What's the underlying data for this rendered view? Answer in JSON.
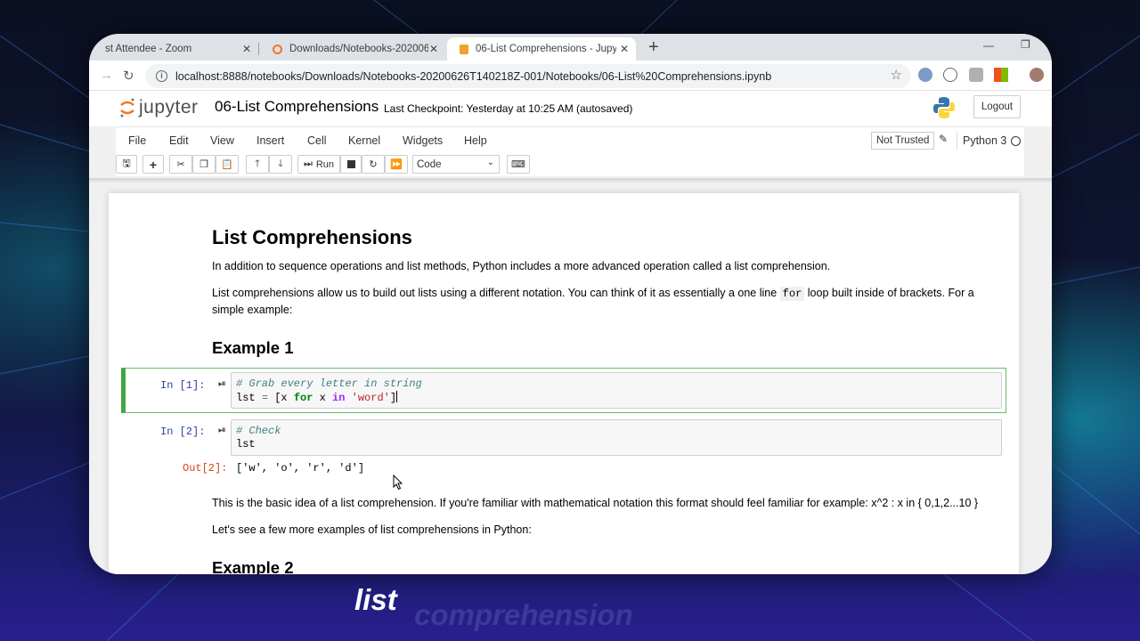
{
  "browser": {
    "tabs": [
      {
        "label": "st Attendee - Zoom"
      },
      {
        "label": "Downloads/Notebooks-2020062..."
      },
      {
        "label": "06-List Comprehensions - Jupyte"
      }
    ],
    "url": "localhost:8888/notebooks/Downloads/Notebooks-20200626T140218Z-001/Notebooks/06-List%20Comprehensions.ipynb"
  },
  "jupyter": {
    "logo_text": "jupyter",
    "notebook_title": "06-List Comprehensions",
    "checkpoint": "Last Checkpoint: Yesterday at 10:25 AM",
    "autosaved": "(autosaved)",
    "logout_label": "Logout",
    "menu": [
      "File",
      "Edit",
      "View",
      "Insert",
      "Cell",
      "Kernel",
      "Widgets",
      "Help"
    ],
    "trust_label": "Not Trusted",
    "kernel_name": "Python 3",
    "toolbar": {
      "run_label": "Run",
      "cell_type": "Code"
    }
  },
  "notebook": {
    "heading": "List Comprehensions",
    "para1": "In addition to sequence operations and list methods, Python includes a more advanced operation called a list comprehension.",
    "para2_a": "List comprehensions allow us to build out lists using a different notation. You can think of it as essentially a one line",
    "para2_code": "for",
    "para2_b": "loop built inside of brackets. For a",
    "para2_c": "simple example:",
    "example1": "Example 1",
    "cell1": {
      "prompt": "In [1]:",
      "line1_comment": "# Grab every letter in string",
      "line2_var": "lst",
      "line2_eq": "=",
      "line2_open": "[x",
      "line2_for": "for",
      "line2_x": "x",
      "line2_in": "in",
      "line2_str": "'word'",
      "line2_close": "]"
    },
    "cell2": {
      "prompt": "In [2]:",
      "line1_comment": "# Check",
      "line2": "lst",
      "out_prompt": "Out[2]:",
      "output": "['w', 'o', 'r', 'd']"
    },
    "para3": "This is the basic idea of a list comprehension. If you're familiar with mathematical notation this format should feel familiar for example: x^2 : x in { 0,1,2...10 }",
    "para4": "Let's see a few more examples of list comprehensions in Python:",
    "example2": "Example 2"
  },
  "subtitle": {
    "word1": "list",
    "word2": "comprehension"
  },
  "colors": {
    "selected_cell_border": "#42a548",
    "prompt_in": "#303f9f",
    "prompt_out": "#d84315"
  }
}
